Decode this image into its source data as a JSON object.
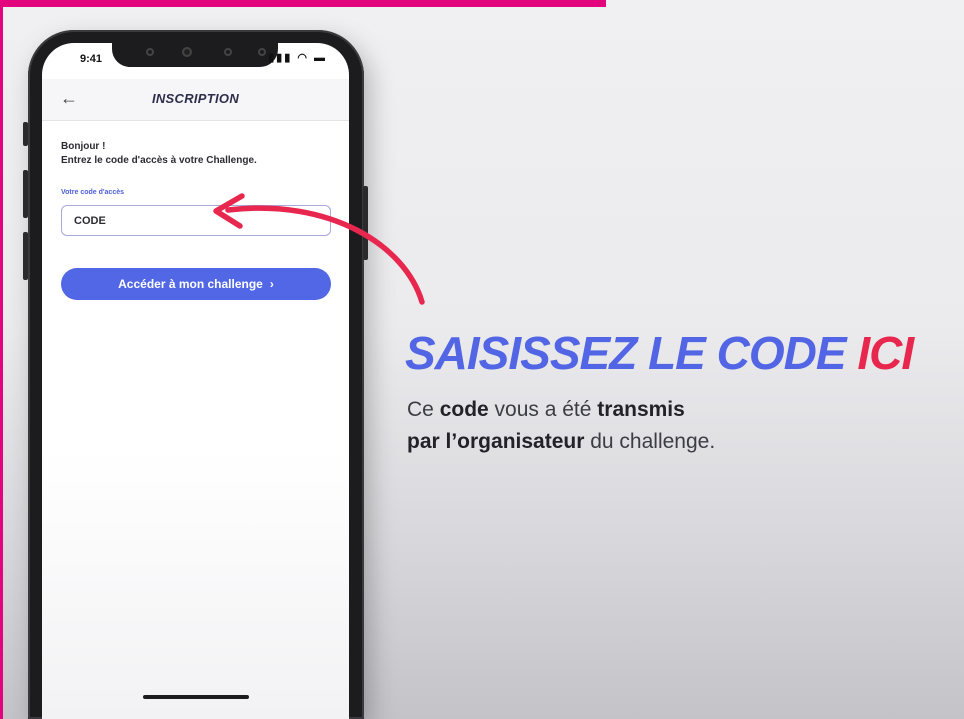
{
  "colors": {
    "brand_pink": "#e3057e",
    "headline_blue": "#5265e4",
    "headline_red": "#e8274f",
    "button_blue": "#5167e6",
    "arrow_red": "#e8274f"
  },
  "status_bar": {
    "time": "9:41",
    "icons": [
      "signal-icon",
      "wifi-icon",
      "battery-icon"
    ]
  },
  "app": {
    "title": "INSCRIPTION",
    "back_icon": "arrow-left-icon",
    "greeting": "Bonjour !",
    "instruction": "Entrez le code d'accès à votre Challenge.",
    "field_label": "Votre code d'accès",
    "field_placeholder": "CODE",
    "field_value": "",
    "button_label": "Accéder à mon challenge",
    "button_icon": "chevron-right-icon"
  },
  "headline": {
    "part1": "SAISISSEZ LE CODE ",
    "part2": "ICI"
  },
  "subtext": {
    "line1": {
      "w1": "Ce ",
      "w2": "code",
      "w3": " vous a été ",
      "w4": "transmis"
    },
    "line2": {
      "w1": "par l’organisateur",
      "w2": " du challenge."
    }
  }
}
